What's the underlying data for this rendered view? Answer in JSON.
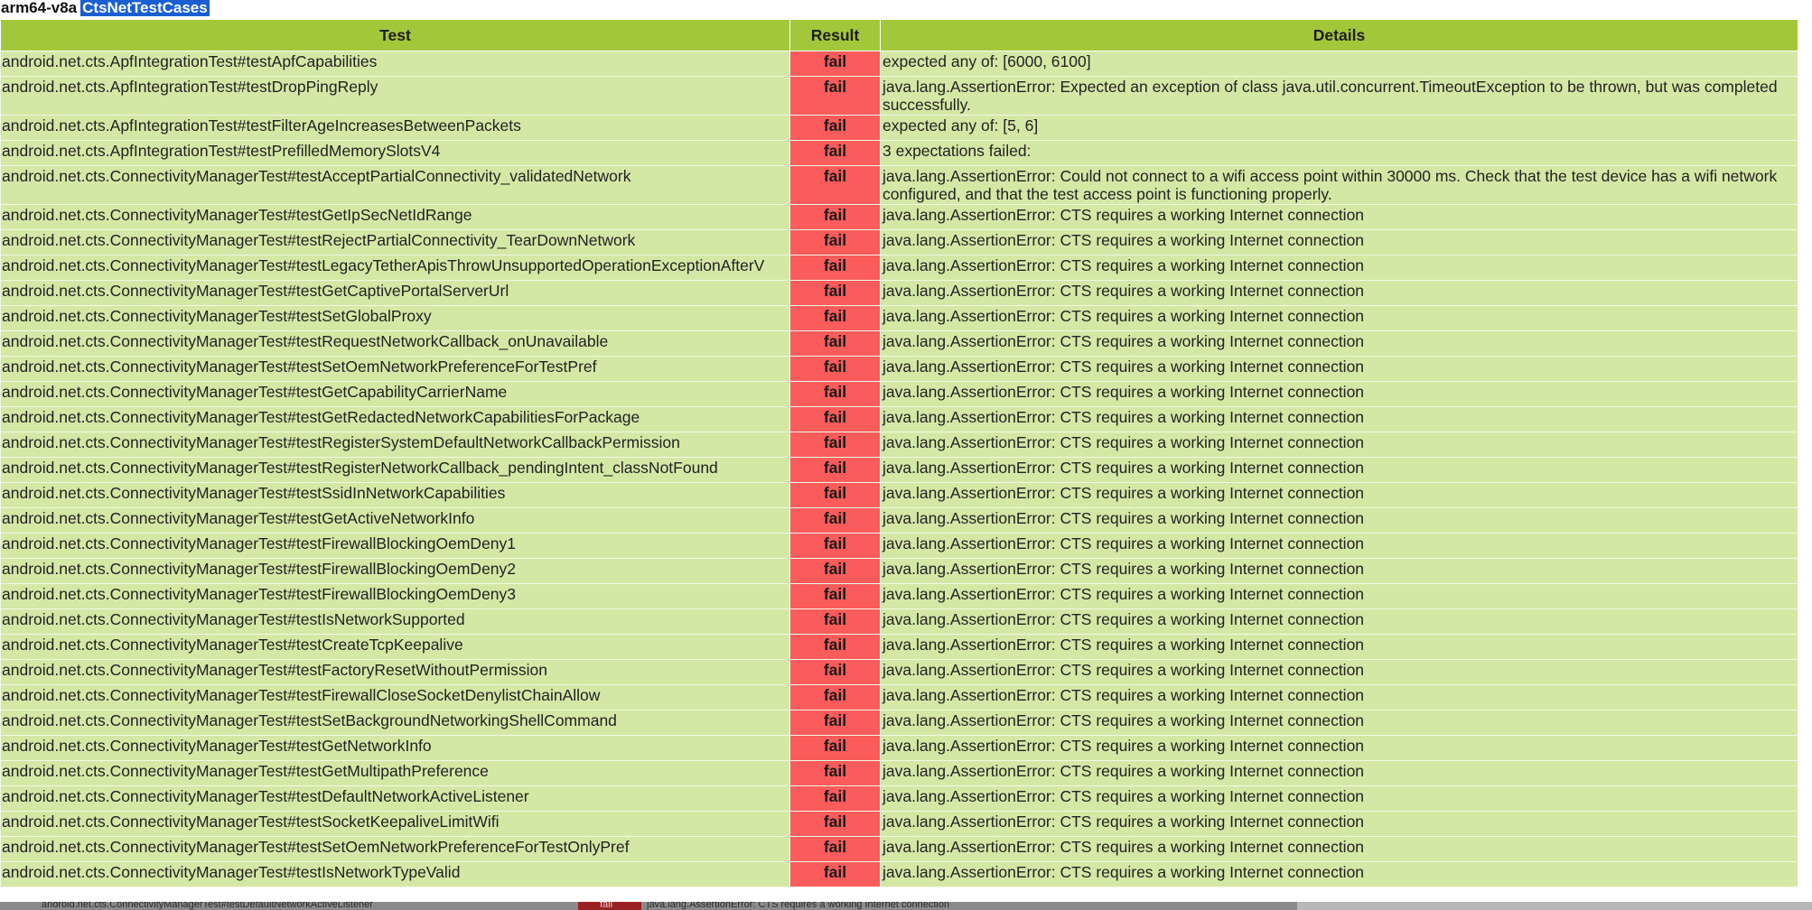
{
  "header": {
    "prefix": "arm64-v8a",
    "module": "CtsNetTestCases"
  },
  "table": {
    "columns": [
      "Test",
      "Result",
      "Details"
    ],
    "rows": [
      {
        "test": "android.net.cts.ApfIntegrationTest#testApfCapabilities",
        "result": "fail",
        "details": "expected any of: [6000, 6100]"
      },
      {
        "test": "android.net.cts.ApfIntegrationTest#testDropPingReply",
        "result": "fail",
        "details": "java.lang.AssertionError: Expected an exception of class java.util.concurrent.TimeoutException to be thrown, but was completed successfully."
      },
      {
        "test": "android.net.cts.ApfIntegrationTest#testFilterAgeIncreasesBetweenPackets",
        "result": "fail",
        "details": "expected any of: [5, 6]"
      },
      {
        "test": "android.net.cts.ApfIntegrationTest#testPrefilledMemorySlotsV4",
        "result": "fail",
        "details": "3 expectations failed:"
      },
      {
        "test": "android.net.cts.ConnectivityManagerTest#testAcceptPartialConnectivity_validatedNetwork",
        "result": "fail",
        "details": "java.lang.AssertionError: Could not connect to a wifi access point within 30000 ms. Check that the test device has a wifi network configured, and that the test access point is functioning properly."
      },
      {
        "test": "android.net.cts.ConnectivityManagerTest#testGetIpSecNetIdRange",
        "result": "fail",
        "details": "java.lang.AssertionError: CTS requires a working Internet connection"
      },
      {
        "test": "android.net.cts.ConnectivityManagerTest#testRejectPartialConnectivity_TearDownNetwork",
        "result": "fail",
        "details": "java.lang.AssertionError: CTS requires a working Internet connection"
      },
      {
        "test": "android.net.cts.ConnectivityManagerTest#testLegacyTetherApisThrowUnsupportedOperationExceptionAfterV",
        "result": "fail",
        "details": "java.lang.AssertionError: CTS requires a working Internet connection"
      },
      {
        "test": "android.net.cts.ConnectivityManagerTest#testGetCaptivePortalServerUrl",
        "result": "fail",
        "details": "java.lang.AssertionError: CTS requires a working Internet connection"
      },
      {
        "test": "android.net.cts.ConnectivityManagerTest#testSetGlobalProxy",
        "result": "fail",
        "details": "java.lang.AssertionError: CTS requires a working Internet connection"
      },
      {
        "test": "android.net.cts.ConnectivityManagerTest#testRequestNetworkCallback_onUnavailable",
        "result": "fail",
        "details": "java.lang.AssertionError: CTS requires a working Internet connection"
      },
      {
        "test": "android.net.cts.ConnectivityManagerTest#testSetOemNetworkPreferenceForTestPref",
        "result": "fail",
        "details": "java.lang.AssertionError: CTS requires a working Internet connection"
      },
      {
        "test": "android.net.cts.ConnectivityManagerTest#testGetCapabilityCarrierName",
        "result": "fail",
        "details": "java.lang.AssertionError: CTS requires a working Internet connection"
      },
      {
        "test": "android.net.cts.ConnectivityManagerTest#testGetRedactedNetworkCapabilitiesForPackage",
        "result": "fail",
        "details": "java.lang.AssertionError: CTS requires a working Internet connection"
      },
      {
        "test": "android.net.cts.ConnectivityManagerTest#testRegisterSystemDefaultNetworkCallbackPermission",
        "result": "fail",
        "details": "java.lang.AssertionError: CTS requires a working Internet connection"
      },
      {
        "test": "android.net.cts.ConnectivityManagerTest#testRegisterNetworkCallback_pendingIntent_classNotFound",
        "result": "fail",
        "details": "java.lang.AssertionError: CTS requires a working Internet connection"
      },
      {
        "test": "android.net.cts.ConnectivityManagerTest#testSsidInNetworkCapabilities",
        "result": "fail",
        "details": "java.lang.AssertionError: CTS requires a working Internet connection"
      },
      {
        "test": "android.net.cts.ConnectivityManagerTest#testGetActiveNetworkInfo",
        "result": "fail",
        "details": "java.lang.AssertionError: CTS requires a working Internet connection"
      },
      {
        "test": "android.net.cts.ConnectivityManagerTest#testFirewallBlockingOemDeny1",
        "result": "fail",
        "details": "java.lang.AssertionError: CTS requires a working Internet connection"
      },
      {
        "test": "android.net.cts.ConnectivityManagerTest#testFirewallBlockingOemDeny2",
        "result": "fail",
        "details": "java.lang.AssertionError: CTS requires a working Internet connection"
      },
      {
        "test": "android.net.cts.ConnectivityManagerTest#testFirewallBlockingOemDeny3",
        "result": "fail",
        "details": "java.lang.AssertionError: CTS requires a working Internet connection"
      },
      {
        "test": "android.net.cts.ConnectivityManagerTest#testIsNetworkSupported",
        "result": "fail",
        "details": "java.lang.AssertionError: CTS requires a working Internet connection"
      },
      {
        "test": "android.net.cts.ConnectivityManagerTest#testCreateTcpKeepalive",
        "result": "fail",
        "details": "java.lang.AssertionError: CTS requires a working Internet connection"
      },
      {
        "test": "android.net.cts.ConnectivityManagerTest#testFactoryResetWithoutPermission",
        "result": "fail",
        "details": "java.lang.AssertionError: CTS requires a working Internet connection"
      },
      {
        "test": "android.net.cts.ConnectivityManagerTest#testFirewallCloseSocketDenylistChainAllow",
        "result": "fail",
        "details": "java.lang.AssertionError: CTS requires a working Internet connection"
      },
      {
        "test": "android.net.cts.ConnectivityManagerTest#testSetBackgroundNetworkingShellCommand",
        "result": "fail",
        "details": "java.lang.AssertionError: CTS requires a working Internet connection"
      },
      {
        "test": "android.net.cts.ConnectivityManagerTest#testGetNetworkInfo",
        "result": "fail",
        "details": "java.lang.AssertionError: CTS requires a working Internet connection"
      },
      {
        "test": "android.net.cts.ConnectivityManagerTest#testGetMultipathPreference",
        "result": "fail",
        "details": "java.lang.AssertionError: CTS requires a working Internet connection"
      },
      {
        "test": "android.net.cts.ConnectivityManagerTest#testDefaultNetworkActiveListener",
        "result": "fail",
        "details": "java.lang.AssertionError: CTS requires a working Internet connection"
      },
      {
        "test": "android.net.cts.ConnectivityManagerTest#testSocketKeepaliveLimitWifi",
        "result": "fail",
        "details": "java.lang.AssertionError: CTS requires a working Internet connection"
      },
      {
        "test": "android.net.cts.ConnectivityManagerTest#testSetOemNetworkPreferenceForTestOnlyPref",
        "result": "fail",
        "details": "java.lang.AssertionError: CTS requires a working Internet connection"
      },
      {
        "test": "android.net.cts.ConnectivityManagerTest#testIsNetworkTypeValid",
        "result": "fail",
        "details": "java.lang.AssertionError: CTS requires a working Internet connection"
      }
    ]
  },
  "overlay_strip": {
    "test": "android.net.cts.ConnectivityManagerTest#testDefaultNetworkActiveListener",
    "result": "fail",
    "details": "java.lang.AssertionError: CTS requires a working Internet connection"
  },
  "colors": {
    "header_green": "#a3c73a",
    "row_green": "#d4e8a6",
    "fail_red": "#fa5b5b",
    "selection_blue": "#1a5fd1"
  }
}
